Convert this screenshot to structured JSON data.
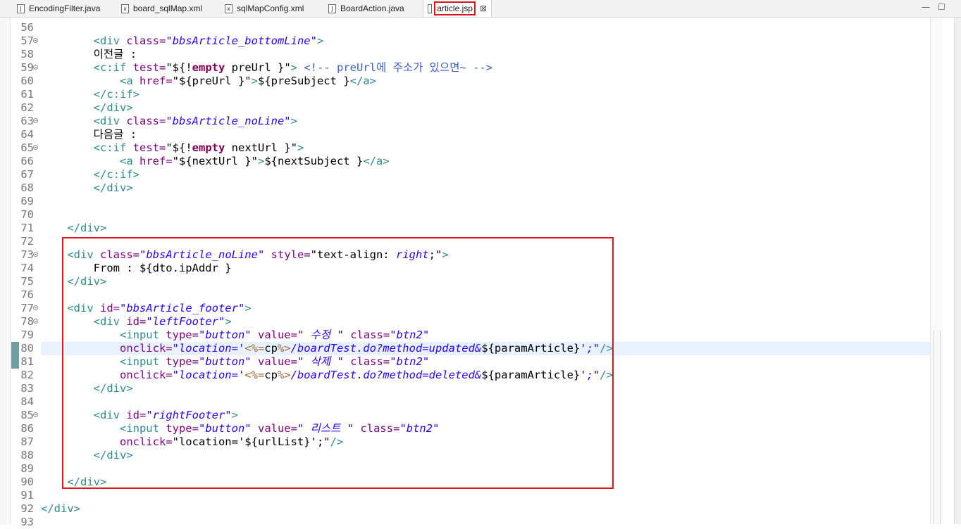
{
  "tabs": [
    {
      "name": "tab-encodingfilter",
      "label": "EncodingFilter.java",
      "icon": "java-file-icon",
      "glyph": "J",
      "active": false
    },
    {
      "name": "tab-board-sqlmap",
      "label": "board_sqlMap.xml",
      "icon": "xml-file-icon",
      "glyph": "x",
      "active": false
    },
    {
      "name": "tab-sqlmapconfig",
      "label": "sqlMapConfig.xml",
      "icon": "xml-file-icon",
      "glyph": "x",
      "active": false
    },
    {
      "name": "tab-boardaction",
      "label": "BoardAction.java",
      "icon": "java-file-icon",
      "glyph": "J",
      "active": false
    },
    {
      "name": "tab-article-jsp",
      "label": "article.jsp",
      "icon": "jsp-file-icon",
      "glyph": "",
      "active": true
    }
  ],
  "window": {
    "close_tab_glyph": "⊠",
    "minimize_glyph": "—",
    "maximize_glyph": "☐"
  },
  "lines": [
    {
      "n": "56",
      "segs": [
        [
          "tx",
          ""
        ]
      ]
    },
    {
      "n": "57",
      "fold": true,
      "segs": [
        [
          "tx",
          "        "
        ],
        [
          "t",
          "<div "
        ],
        [
          "a",
          "class="
        ],
        [
          "v",
          "\"bbsArticle_bottomLine\""
        ],
        [
          "t",
          ">"
        ]
      ]
    },
    {
      "n": "58",
      "segs": [
        [
          "tx",
          "        이전글 :"
        ]
      ]
    },
    {
      "n": "59",
      "fold": true,
      "segs": [
        [
          "tx",
          "        "
        ],
        [
          "t",
          "<c:if "
        ],
        [
          "a",
          "test="
        ],
        [
          "tx",
          "\"${!"
        ],
        [
          "kw",
          "empty"
        ],
        [
          "tx",
          " preUrl }\""
        ],
        [
          "t",
          "> "
        ],
        [
          "cm",
          "<!-- preUrl에 주소가 있으면~ -->"
        ]
      ]
    },
    {
      "n": "60",
      "segs": [
        [
          "tx",
          "            "
        ],
        [
          "t",
          "<a "
        ],
        [
          "a",
          "href="
        ],
        [
          "tx",
          "\"${preUrl }\""
        ],
        [
          "t",
          ">"
        ],
        [
          "tx",
          "${preSubject }"
        ],
        [
          "t",
          "</a>"
        ]
      ]
    },
    {
      "n": "61",
      "segs": [
        [
          "tx",
          "        "
        ],
        [
          "t",
          "</c:if>"
        ]
      ]
    },
    {
      "n": "62",
      "segs": [
        [
          "tx",
          "        "
        ],
        [
          "t",
          "</div>"
        ]
      ]
    },
    {
      "n": "63",
      "fold": true,
      "segs": [
        [
          "tx",
          "        "
        ],
        [
          "t",
          "<div "
        ],
        [
          "a",
          "class="
        ],
        [
          "v",
          "\"bbsArticle_noLine\""
        ],
        [
          "t",
          ">"
        ]
      ]
    },
    {
      "n": "64",
      "segs": [
        [
          "tx",
          "        다음글 :"
        ]
      ]
    },
    {
      "n": "65",
      "fold": true,
      "segs": [
        [
          "tx",
          "        "
        ],
        [
          "t",
          "<c:if "
        ],
        [
          "a",
          "test="
        ],
        [
          "tx",
          "\"${!"
        ],
        [
          "kw",
          "empty"
        ],
        [
          "tx",
          " nextUrl }\""
        ],
        [
          "t",
          ">"
        ]
      ]
    },
    {
      "n": "66",
      "segs": [
        [
          "tx",
          "            "
        ],
        [
          "t",
          "<a "
        ],
        [
          "a",
          "href="
        ],
        [
          "tx",
          "\"${nextUrl }\""
        ],
        [
          "t",
          ">"
        ],
        [
          "tx",
          "${nextSubject }"
        ],
        [
          "t",
          "</a>"
        ]
      ]
    },
    {
      "n": "67",
      "segs": [
        [
          "tx",
          "        "
        ],
        [
          "t",
          "</c:if>"
        ]
      ]
    },
    {
      "n": "68",
      "segs": [
        [
          "tx",
          "        "
        ],
        [
          "t",
          "</div>"
        ]
      ]
    },
    {
      "n": "69",
      "segs": [
        [
          "tx",
          ""
        ]
      ]
    },
    {
      "n": "70",
      "segs": [
        [
          "tx",
          ""
        ]
      ]
    },
    {
      "n": "71",
      "segs": [
        [
          "tx",
          "    "
        ],
        [
          "t",
          "</div>"
        ]
      ]
    },
    {
      "n": "72",
      "segs": [
        [
          "tx",
          ""
        ]
      ]
    },
    {
      "n": "73",
      "fold": true,
      "segs": [
        [
          "tx",
          "    "
        ],
        [
          "t",
          "<div "
        ],
        [
          "a",
          "class="
        ],
        [
          "v",
          "\"bbsArticle_noLine\""
        ],
        [
          "tx",
          " "
        ],
        [
          "a",
          "style="
        ],
        [
          "tx",
          "\"text-align: "
        ],
        [
          "v",
          "right"
        ],
        [
          "tx",
          ";\""
        ],
        [
          "t",
          ">"
        ]
      ]
    },
    {
      "n": "74",
      "segs": [
        [
          "tx",
          "        From : ${dto.ipAddr }"
        ]
      ]
    },
    {
      "n": "75",
      "segs": [
        [
          "tx",
          "    "
        ],
        [
          "t",
          "</div>"
        ]
      ]
    },
    {
      "n": "76",
      "segs": [
        [
          "tx",
          ""
        ]
      ]
    },
    {
      "n": "77",
      "fold": true,
      "segs": [
        [
          "tx",
          "    "
        ],
        [
          "t",
          "<div "
        ],
        [
          "a",
          "id="
        ],
        [
          "v",
          "\"bbsArticle_footer\""
        ],
        [
          "t",
          ">"
        ]
      ]
    },
    {
      "n": "78",
      "fold": true,
      "segs": [
        [
          "tx",
          "        "
        ],
        [
          "t",
          "<div "
        ],
        [
          "a",
          "id="
        ],
        [
          "v",
          "\"leftFooter\""
        ],
        [
          "t",
          ">"
        ]
      ]
    },
    {
      "n": "79",
      "segs": [
        [
          "tx",
          "            "
        ],
        [
          "t",
          "<input "
        ],
        [
          "a",
          "type="
        ],
        [
          "v",
          "\"button\""
        ],
        [
          "tx",
          " "
        ],
        [
          "a",
          "value="
        ],
        [
          "v",
          "\" 수정 \""
        ],
        [
          "tx",
          " "
        ],
        [
          "a",
          "class="
        ],
        [
          "v",
          "\"btn2\""
        ]
      ]
    },
    {
      "n": "80",
      "current": true,
      "segs": [
        [
          "tx",
          "            "
        ],
        [
          "a",
          "onclick="
        ],
        [
          "v",
          "\"location='"
        ],
        [
          "jsp",
          "<%="
        ],
        [
          "tx",
          "cp"
        ],
        [
          "jsp",
          "%>"
        ],
        [
          "v",
          "/boardTest.do?method=updated&"
        ],
        [
          "tx",
          "${paramArticle}"
        ],
        [
          "v",
          "';\""
        ],
        [
          "t",
          "/>"
        ]
      ]
    },
    {
      "n": "81",
      "segs": [
        [
          "tx",
          "            "
        ],
        [
          "t",
          "<input "
        ],
        [
          "a",
          "type="
        ],
        [
          "v",
          "\"button\""
        ],
        [
          "tx",
          " "
        ],
        [
          "a",
          "value="
        ],
        [
          "v",
          "\" 삭제 \""
        ],
        [
          "tx",
          " "
        ],
        [
          "a",
          "class="
        ],
        [
          "v",
          "\"btn2\""
        ]
      ]
    },
    {
      "n": "82",
      "segs": [
        [
          "tx",
          "            "
        ],
        [
          "a",
          "onclick="
        ],
        [
          "v",
          "\"location='"
        ],
        [
          "jsp",
          "<%="
        ],
        [
          "tx",
          "cp"
        ],
        [
          "jsp",
          "%>"
        ],
        [
          "v",
          "/boardTest.do?method=deleted&"
        ],
        [
          "tx",
          "${paramArticle}"
        ],
        [
          "v",
          "';\""
        ],
        [
          "t",
          "/>"
        ]
      ]
    },
    {
      "n": "83",
      "segs": [
        [
          "tx",
          "        "
        ],
        [
          "t",
          "</div>"
        ]
      ]
    },
    {
      "n": "84",
      "segs": [
        [
          "tx",
          ""
        ]
      ]
    },
    {
      "n": "85",
      "fold": true,
      "segs": [
        [
          "tx",
          "        "
        ],
        [
          "t",
          "<div "
        ],
        [
          "a",
          "id="
        ],
        [
          "v",
          "\"rightFooter\""
        ],
        [
          "t",
          ">"
        ]
      ]
    },
    {
      "n": "86",
      "segs": [
        [
          "tx",
          "            "
        ],
        [
          "t",
          "<input "
        ],
        [
          "a",
          "type="
        ],
        [
          "v",
          "\"button\""
        ],
        [
          "tx",
          " "
        ],
        [
          "a",
          "value="
        ],
        [
          "v",
          "\" 리스트 \""
        ],
        [
          "tx",
          " "
        ],
        [
          "a",
          "class="
        ],
        [
          "v",
          "\"btn2\""
        ]
      ]
    },
    {
      "n": "87",
      "segs": [
        [
          "tx",
          "            "
        ],
        [
          "a",
          "onclick="
        ],
        [
          "tx",
          "\"location='${urlList}';\""
        ],
        [
          "t",
          "/>"
        ]
      ]
    },
    {
      "n": "88",
      "segs": [
        [
          "tx",
          "        "
        ],
        [
          "t",
          "</div>"
        ]
      ]
    },
    {
      "n": "89",
      "segs": [
        [
          "tx",
          ""
        ]
      ]
    },
    {
      "n": "90",
      "segs": [
        [
          "tx",
          "    "
        ],
        [
          "t",
          "</div>"
        ]
      ]
    },
    {
      "n": "91",
      "segs": [
        [
          "tx",
          ""
        ]
      ]
    },
    {
      "n": "92",
      "segs": [
        [
          "t",
          "</div>"
        ]
      ]
    },
    {
      "n": "93",
      "segs": [
        [
          "tx",
          ""
        ]
      ]
    }
  ],
  "colors": {
    "highlight": "#e0161d",
    "current_line": "#e8f2fe",
    "tag": "#2e8b8b",
    "attr": "#7f007f",
    "value": "#2a00ff"
  }
}
